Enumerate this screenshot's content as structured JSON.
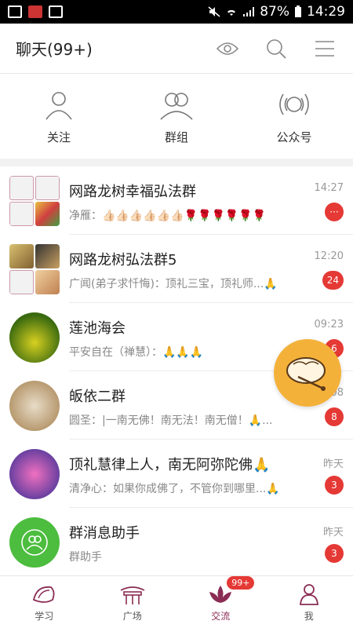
{
  "status_bar": {
    "battery": "87%",
    "time": "14:29"
  },
  "header": {
    "title": "聊天(99+)"
  },
  "quick_actions": [
    {
      "label": "关注"
    },
    {
      "label": "群组"
    },
    {
      "label": "公众号"
    }
  ],
  "chats": [
    {
      "name": "网路龙树幸福弘法群",
      "message": "净雁：👍🏻👍🏻👍🏻👍🏻👍🏻👍🏻🌹🌹🌹🌹🌹🌹",
      "time": "14:27",
      "badge": "···"
    },
    {
      "name": "网路龙树弘法群5",
      "message": "广闻(弟子求忏悔)：顶礼三宝，顶礼师...🙏",
      "time": "12:20",
      "badge": "24"
    },
    {
      "name": "莲池海会",
      "message": "平安自在（禅慧）：🙏🙏🙏",
      "time": "09:23",
      "badge": "6"
    },
    {
      "name": "皈依二群",
      "message": "圆圣：|一南无佛！南无法！南无僧！🙏...",
      "time": "08",
      "badge": "8"
    },
    {
      "name": "顶礼慧律上人，南无阿弥陀佛🙏",
      "message": "清净心：如果你成佛了，不管你到哪里...🙏",
      "time": "昨天",
      "badge": "3"
    },
    {
      "name": "群消息助手",
      "message": "群助手",
      "time": "昨天",
      "badge": "3"
    }
  ],
  "tabs": [
    {
      "label": "学习"
    },
    {
      "label": "广场"
    },
    {
      "label": "交流",
      "badge": "99+"
    },
    {
      "label": "我"
    }
  ],
  "colors": {
    "accent": "#8a2d54",
    "badge": "#e53935",
    "float": "#f4b13a",
    "assistant_avatar": "#4cbd3e"
  }
}
